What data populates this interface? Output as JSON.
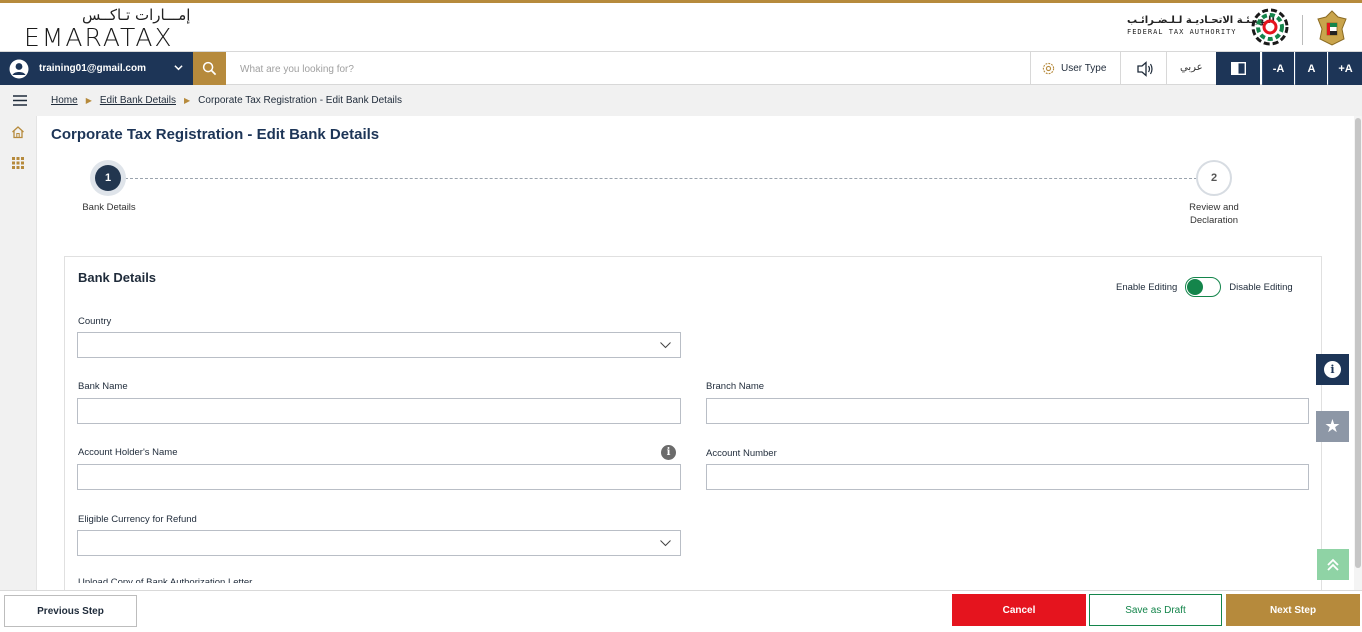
{
  "header": {
    "logo_ar": "إمـــارات تـاكــس",
    "logo_en": "EMARATAX",
    "fta_ar": "الـهيـئـة الاتحـاديـة لـلـضـرائـب",
    "fta_en": "FEDERAL TAX AUTHORITY"
  },
  "toolbar": {
    "user_email": "training01@gmail.com",
    "search_placeholder": "What are you looking for?",
    "user_type_label": "User Type",
    "language_label": "عربي",
    "font_decrease": "-A",
    "font_normal": "A",
    "font_increase": "+A"
  },
  "breadcrumb": {
    "home": "Home",
    "edit_bank": "Edit Bank Details",
    "current": "Corporate Tax Registration - Edit Bank Details"
  },
  "page": {
    "title": "Corporate Tax Registration - Edit Bank Details"
  },
  "stepper": {
    "steps": [
      {
        "number": "1",
        "label": "Bank Details",
        "state": "active"
      },
      {
        "number": "2",
        "label_line1": "Review and",
        "label_line2": "Declaration",
        "state": "pending"
      }
    ]
  },
  "form": {
    "section_title": "Bank Details",
    "enable_editing": "Enable Editing",
    "disable_editing": "Disable Editing",
    "country_label": "Country",
    "country_value": "",
    "bank_name_label": "Bank Name",
    "bank_name_value": "",
    "branch_name_label": "Branch Name",
    "branch_name_value": "",
    "holder_name_label": "Account Holder's Name",
    "holder_name_value": "",
    "account_number_label": "Account Number",
    "account_number_value": "",
    "currency_label": "Eligible Currency for Refund",
    "currency_value": "",
    "partial_label": "Upload Copy of Bank Authorization Letter"
  },
  "footer": {
    "previous": "Previous Step",
    "cancel": "Cancel",
    "save_draft": "Save as Draft",
    "next": "Next Step"
  },
  "colors": {
    "navy": "#1d3557",
    "gold": "#b68a3c",
    "red": "#e5141e",
    "green": "#14854b"
  }
}
